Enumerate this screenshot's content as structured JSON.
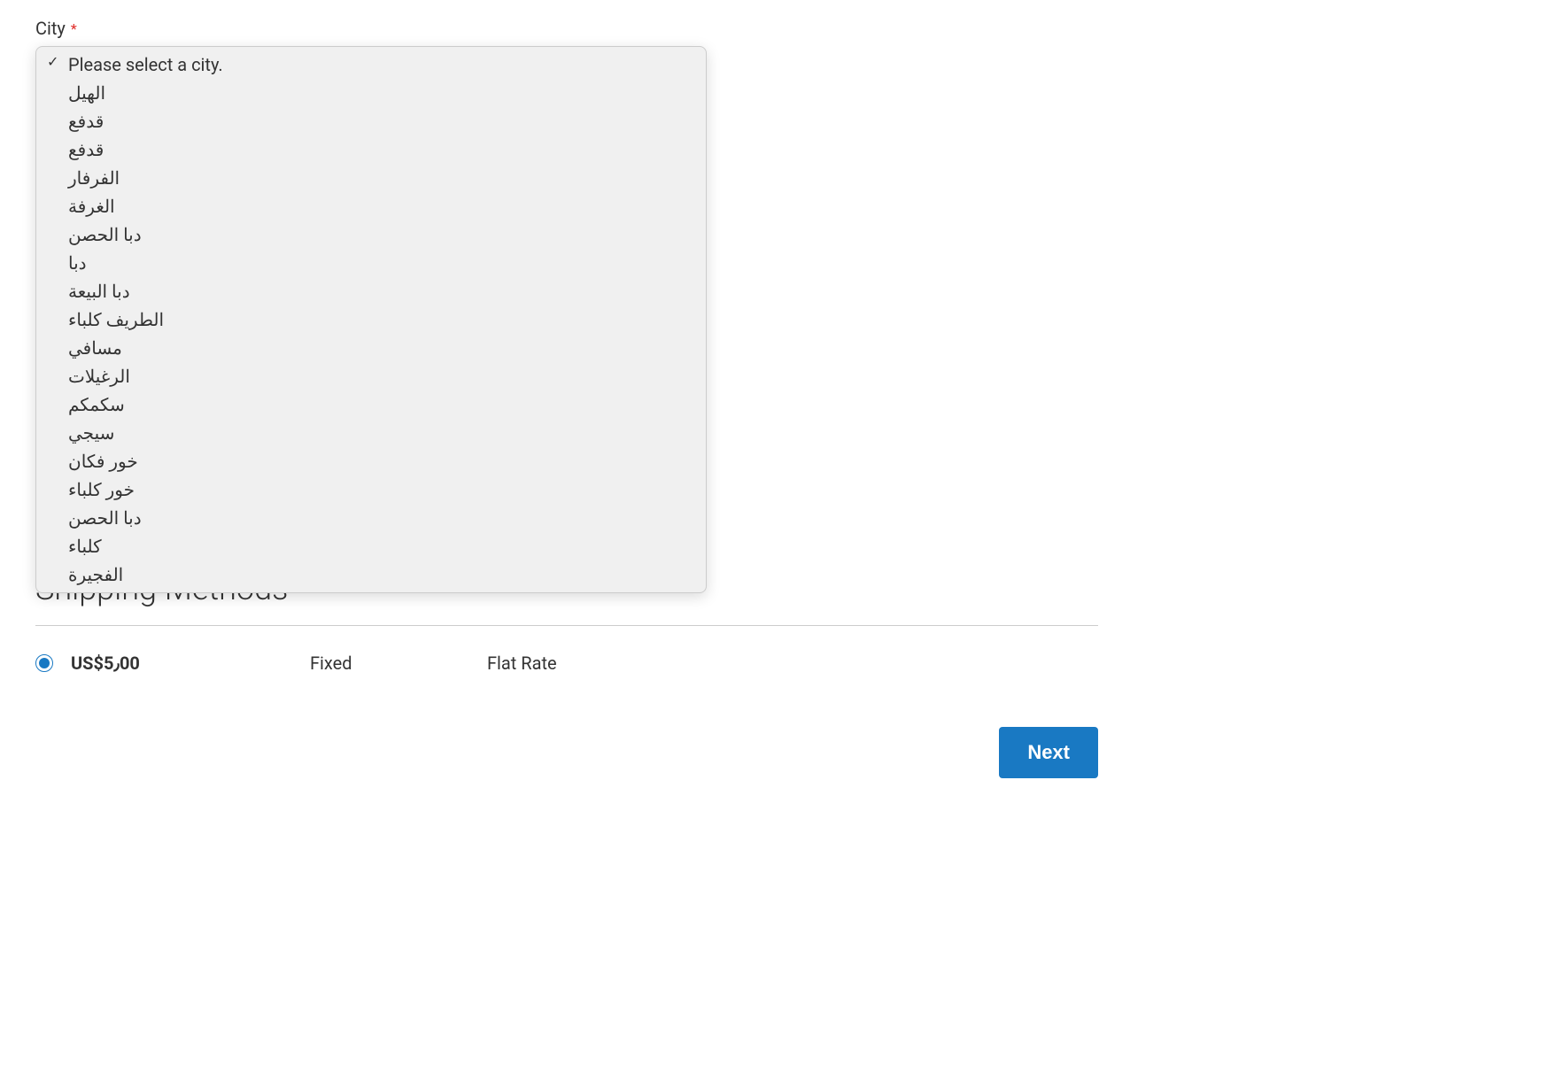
{
  "city_field": {
    "label": "City",
    "required_mark": "*",
    "placeholder_option": "Please select a city.",
    "options": [
      "الهيل",
      "قدفع",
      "قدفع",
      "الفرفار",
      "الغرفة",
      "دبا الحصن",
      "دبا",
      "دبا البيعة",
      "الطريف كلباء",
      "مسافي",
      "الرغيلات",
      "سكمكم",
      "سيجي",
      "خور فكان",
      "خور كلباء",
      "دبا الحصن",
      "كلباء",
      "الفجيرة"
    ]
  },
  "shipping": {
    "title": "Shipping Methods",
    "method": {
      "price": "US$5٫00",
      "type": "Fixed",
      "name": "Flat Rate"
    }
  },
  "next_button": "Next"
}
